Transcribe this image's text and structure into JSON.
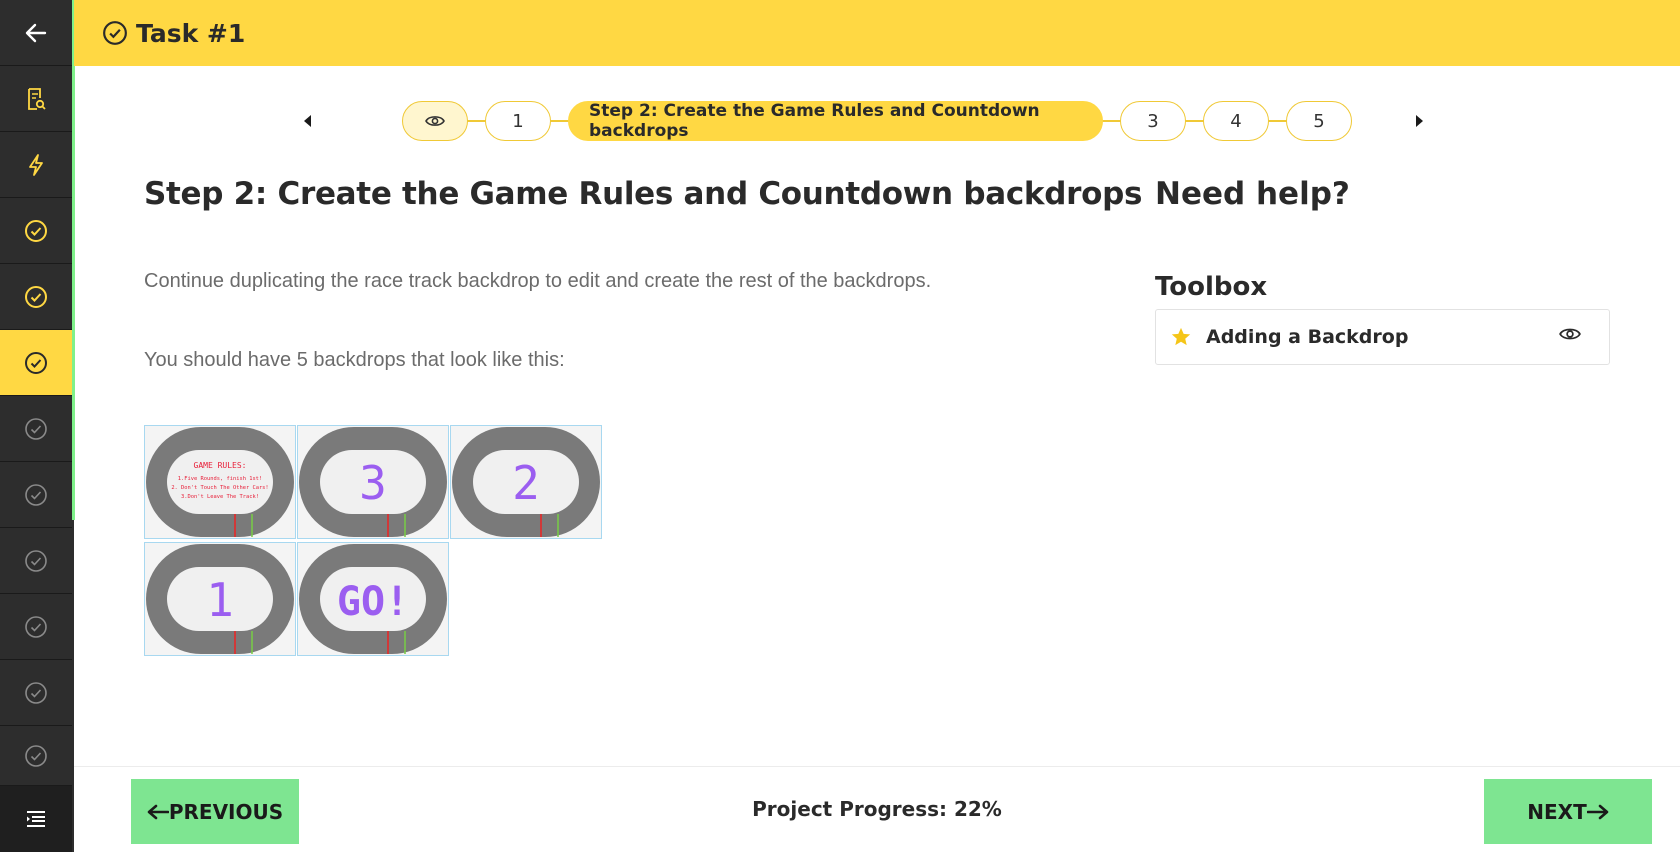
{
  "header": {
    "title": "Task #1"
  },
  "sidebar": {
    "items": [
      {
        "icon": "arrow-left-icon",
        "state": "back"
      },
      {
        "icon": "document-search-icon",
        "state": "default"
      },
      {
        "icon": "lightning-icon",
        "state": "default"
      },
      {
        "icon": "check-circle-icon",
        "state": "completed"
      },
      {
        "icon": "check-circle-icon",
        "state": "completed"
      },
      {
        "icon": "check-circle-icon",
        "state": "active"
      },
      {
        "icon": "check-circle-icon",
        "state": "locked"
      },
      {
        "icon": "check-circle-icon",
        "state": "locked"
      },
      {
        "icon": "check-circle-icon",
        "state": "locked"
      },
      {
        "icon": "check-circle-icon",
        "state": "locked"
      },
      {
        "icon": "check-circle-icon",
        "state": "locked"
      },
      {
        "icon": "check-circle-icon",
        "state": "locked"
      }
    ],
    "menu_icon": "menu-list-icon"
  },
  "step_nav": {
    "steps": [
      "1",
      "Step 2: Create the Game Rules and Countdown backdrops",
      "3",
      "4",
      "5"
    ],
    "current_index": 1
  },
  "main": {
    "heading": "Step 2: Create the Game Rules and Countdown backdrops",
    "paragraph1": "Continue duplicating the race track backdrop to edit and create the rest of the backdrops.",
    "paragraph2": "You should have 5 backdrops that look like this:",
    "backdrops": [
      {
        "kind": "rules",
        "title": "GAME RULES:",
        "lines": [
          "1.Five Rounds, finish 1st!",
          "2. Don't Touch The Other Cars!",
          "3.Don't Leave The Track!"
        ]
      },
      {
        "kind": "big",
        "label": "3"
      },
      {
        "kind": "big",
        "label": "2"
      },
      {
        "kind": "big",
        "label": "1"
      },
      {
        "kind": "big",
        "label": "GO!"
      }
    ]
  },
  "help": {
    "heading": "Need help?",
    "toolbox_heading": "Toolbox",
    "toolbox_item": "Adding a Backdrop"
  },
  "footer": {
    "prev_label": "PREVIOUS",
    "next_label": "NEXT",
    "progress_text": "Project Progress: 22%",
    "progress": 0.22
  },
  "colors": {
    "accent": "#ffd843",
    "nav_button": "#7ee591",
    "sidebar": "#2d2d2d",
    "countdown_text": "#9b5ef0",
    "rules_text": "#e8203a"
  }
}
